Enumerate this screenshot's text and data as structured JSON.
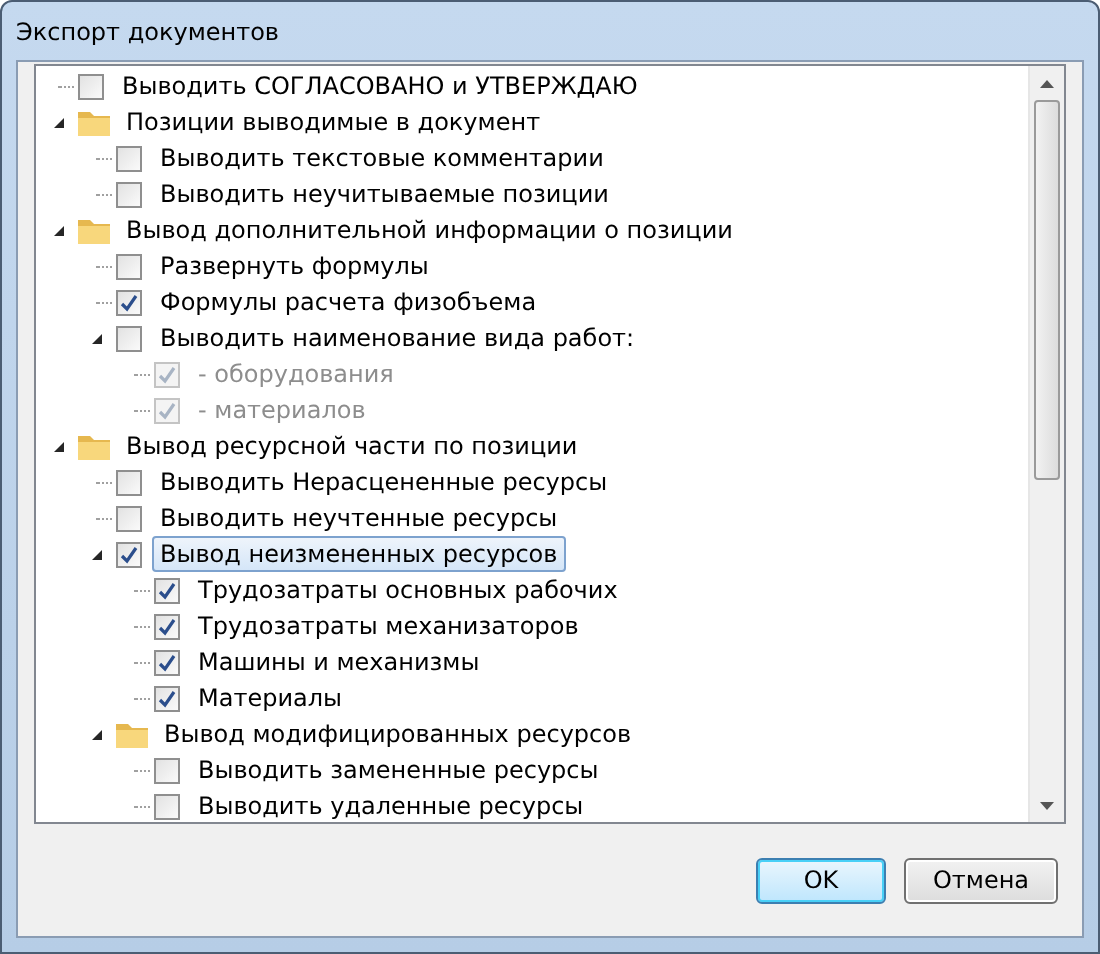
{
  "window": {
    "title": "Экспорт документов"
  },
  "tree": [
    {
      "kind": "check",
      "label": "Выводить СОГЛАСОВАНО и УТВЕРЖДАЮ",
      "checked": false,
      "disabled": false,
      "selected": false
    },
    {
      "kind": "folder",
      "label": "Позиции выводимые в документ",
      "expanded": true,
      "selected": false,
      "children": [
        {
          "kind": "check",
          "label": "Выводить текстовые комментарии",
          "checked": false,
          "disabled": false,
          "selected": false
        },
        {
          "kind": "check",
          "label": "Выводить неучитываемые позиции",
          "checked": false,
          "disabled": false,
          "selected": false
        }
      ]
    },
    {
      "kind": "folder",
      "label": "Вывод дополнительной информации о позиции",
      "expanded": true,
      "selected": false,
      "children": [
        {
          "kind": "check",
          "label": "Развернуть формулы",
          "checked": false,
          "disabled": false,
          "selected": false
        },
        {
          "kind": "check",
          "label": "Формулы расчета физобъема",
          "checked": true,
          "disabled": false,
          "selected": false
        },
        {
          "kind": "check",
          "label": "Выводить наименование вида работ:",
          "checked": false,
          "disabled": false,
          "selected": false,
          "expanded": true,
          "children": [
            {
              "kind": "check",
              "label": "- оборудования",
              "checked": true,
              "disabled": true,
              "selected": false
            },
            {
              "kind": "check",
              "label": "- материалов",
              "checked": true,
              "disabled": true,
              "selected": false
            }
          ]
        }
      ]
    },
    {
      "kind": "folder",
      "label": "Вывод ресурсной части по позиции",
      "expanded": true,
      "selected": false,
      "children": [
        {
          "kind": "check",
          "label": "Выводить Нерасцененные ресурсы",
          "checked": false,
          "disabled": false,
          "selected": false
        },
        {
          "kind": "check",
          "label": "Выводить неучтенные ресурсы",
          "checked": false,
          "disabled": false,
          "selected": false
        },
        {
          "kind": "check",
          "label": "Вывод неизмененных ресурсов",
          "checked": true,
          "disabled": false,
          "selected": true,
          "expanded": true,
          "children": [
            {
              "kind": "check",
              "label": "Трудозатраты основных рабочих",
              "checked": true,
              "disabled": false,
              "selected": false
            },
            {
              "kind": "check",
              "label": "Трудозатраты механизаторов",
              "checked": true,
              "disabled": false,
              "selected": false
            },
            {
              "kind": "check",
              "label": "Машины и механизмы",
              "checked": true,
              "disabled": false,
              "selected": false
            },
            {
              "kind": "check",
              "label": "Материалы",
              "checked": true,
              "disabled": false,
              "selected": false
            }
          ]
        },
        {
          "kind": "folder",
          "label": "Вывод модифицированных ресурсов",
          "expanded": true,
          "selected": false,
          "children": [
            {
              "kind": "check",
              "label": "Выводить замененные ресурсы",
              "checked": false,
              "disabled": false,
              "selected": false
            },
            {
              "kind": "check",
              "label": "Выводить удаленные ресурсы",
              "checked": false,
              "disabled": false,
              "selected": false
            }
          ]
        }
      ]
    }
  ],
  "buttons": [
    {
      "label": "OK",
      "default": true
    },
    {
      "label": "Отмена",
      "default": false
    }
  ]
}
